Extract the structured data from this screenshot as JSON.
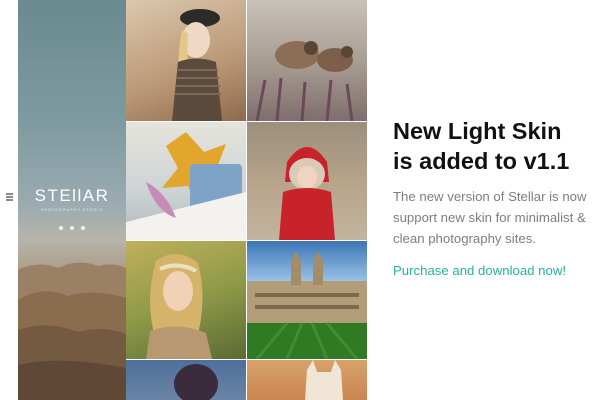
{
  "sidebar": {
    "brand_name": "STEllAR",
    "brand_subtitle": "PHOTOGRAPHY STUDIO",
    "social_icons": [
      "facebook-icon",
      "twitter-icon",
      "google-icon"
    ],
    "menu_icon": "hamburger-icon"
  },
  "gallery": {
    "tiles": [
      "woman-black-beret-photo",
      "sparrows-photo",
      "autumn-leaves-still-life-photo",
      "child-red-coat-snow-photo",
      "woman-flower-crown-photo",
      "college-building-lawn-photo",
      "woman-blue-photo",
      "cat-photo"
    ]
  },
  "promo": {
    "headline_line1": "New Light Skin",
    "headline_line2": "is added to v1.1",
    "description_line1": "The new version of Stellar is now",
    "description_line2": "support new skin for minimalist &",
    "description_line3": "clean photography sites.",
    "cta": "Purchase and download now!"
  },
  "colors": {
    "accent": "#27b3a0",
    "headline": "#111111",
    "description": "#7d7d7d"
  }
}
